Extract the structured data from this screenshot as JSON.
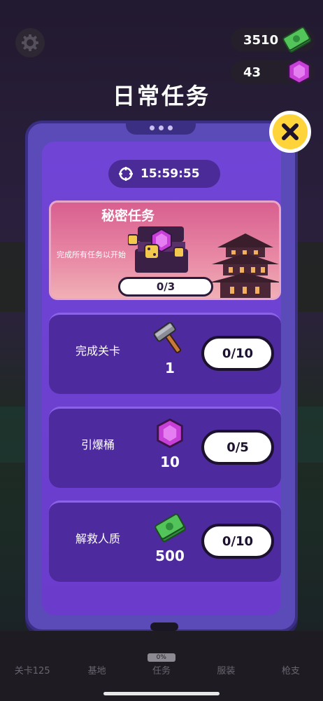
{
  "header": {
    "cash_amount": "3510",
    "gem_amount": "43",
    "title": "日常任务"
  },
  "panel": {
    "timer": "15:59:55",
    "secret": {
      "title": "秘密任务",
      "description": "完成所有任务以开始",
      "progress": "0/3"
    },
    "tasks": [
      {
        "label": "完成关卡",
        "reward_icon": "hammer-icon",
        "reward_amount": "1",
        "progress": "0/10"
      },
      {
        "label": "引爆桶",
        "reward_icon": "gem-icon",
        "reward_amount": "10",
        "progress": "0/5"
      },
      {
        "label": "解救人质",
        "reward_icon": "cash-icon",
        "reward_amount": "500",
        "progress": "0/10"
      }
    ]
  },
  "bottom_nav": {
    "items": [
      {
        "label": "关卡125"
      },
      {
        "label": "基地"
      },
      {
        "label": "任务",
        "badge": "0%"
      },
      {
        "label": "服装"
      },
      {
        "label": "枪支"
      }
    ]
  },
  "colors": {
    "accent_yellow": "#ffd43a",
    "panel_purple": "#6b3ccc",
    "task_card": "#4d2a9e",
    "secret_pink": "#d85f8f"
  }
}
